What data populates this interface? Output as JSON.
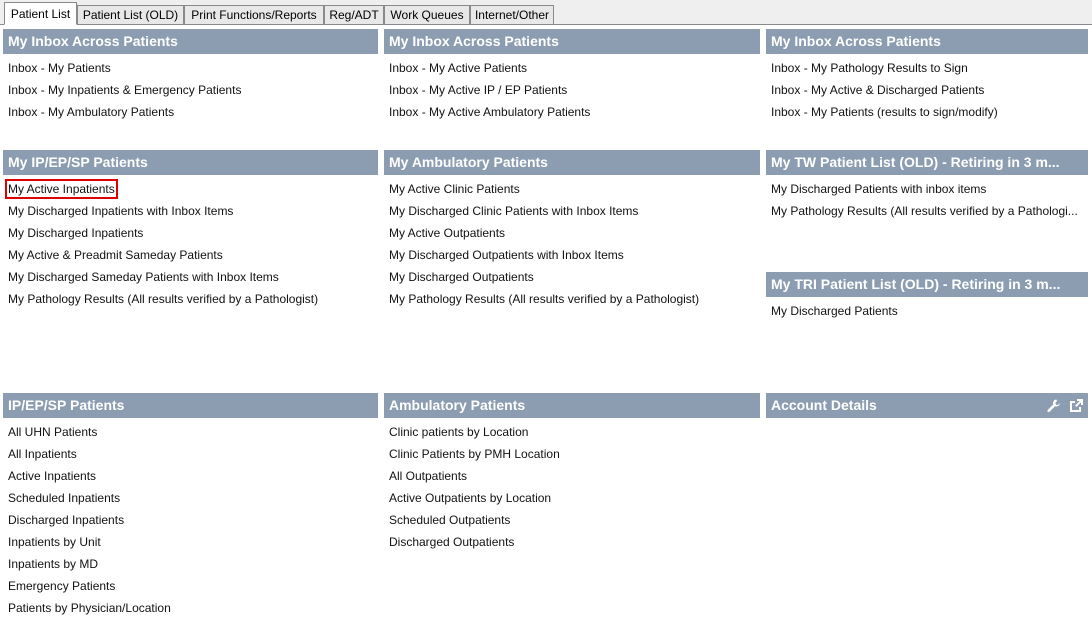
{
  "tabs": [
    {
      "label": "Patient List"
    },
    {
      "label": "Patient List (OLD)"
    },
    {
      "label": "Print Functions/Reports"
    },
    {
      "label": "Reg/ADT"
    },
    {
      "label": "Work Queues"
    },
    {
      "label": "Internet/Other"
    }
  ],
  "panels": {
    "inbox1": {
      "title": "My Inbox Across Patients",
      "items": [
        "Inbox - My Patients",
        "Inbox - My Inpatients &  Emergency Patients",
        "Inbox - My Ambulatory Patients"
      ]
    },
    "inbox2": {
      "title": "My Inbox Across Patients",
      "items": [
        "Inbox - My Active Patients",
        "Inbox - My Active IP / EP Patients",
        "Inbox - My Active Ambulatory Patients"
      ]
    },
    "inbox3": {
      "title": "My Inbox Across Patients",
      "items": [
        "Inbox - My Pathology Results to Sign",
        "Inbox - My Active & Discharged Patients",
        "Inbox - My Patients (results to sign/modify)"
      ]
    },
    "my_ip": {
      "title": "My IP/EP/SP Patients",
      "items": [
        "My Active Inpatients",
        "My Discharged Inpatients with Inbox Items",
        "My Discharged Inpatients",
        "My Active & Preadmit Sameday Patients",
        "My Discharged Sameday Patients with Inbox Items",
        "My Pathology Results (All results verified by a Pathologist)"
      ]
    },
    "my_amb": {
      "title": "My Ambulatory Patients",
      "items": [
        "My Active Clinic Patients",
        "My Discharged Clinic Patients with Inbox Items",
        "My Active Outpatients",
        "My Discharged Outpatients with Inbox Items",
        "My Discharged Outpatients",
        "My Pathology Results (All results verified by a Pathologist)"
      ]
    },
    "my_tw": {
      "title": "My TW Patient List (OLD) - Retiring in 3 m...",
      "items": [
        "My Discharged Patients with inbox items",
        "My Pathology Results (All results verified by a Pathologi..."
      ]
    },
    "my_tri": {
      "title": "My TRI Patient List (OLD) - Retiring in 3 m...",
      "items": [
        "My Discharged Patients"
      ]
    },
    "ip": {
      "title": "IP/EP/SP Patients",
      "items": [
        "All UHN Patients",
        "All Inpatients",
        "Active Inpatients",
        "Scheduled Inpatients",
        "Discharged Inpatients",
        "Inpatients by Unit",
        "Inpatients by MD",
        "Emergency Patients",
        "Patients by Physician/Location"
      ]
    },
    "amb": {
      "title": "Ambulatory Patients",
      "items": [
        "Clinic patients by Location",
        "Clinic Patients by PMH Location",
        "All Outpatients",
        "Active Outpatients by Location",
        "Scheduled Outpatients",
        "Discharged Outpatients"
      ]
    },
    "account": {
      "title": "Account Details",
      "icons": [
        "wrench-icon",
        "popout-icon"
      ]
    }
  },
  "colors": {
    "header_bg": "#8c9cb1",
    "selected_outline": "#e00000"
  }
}
